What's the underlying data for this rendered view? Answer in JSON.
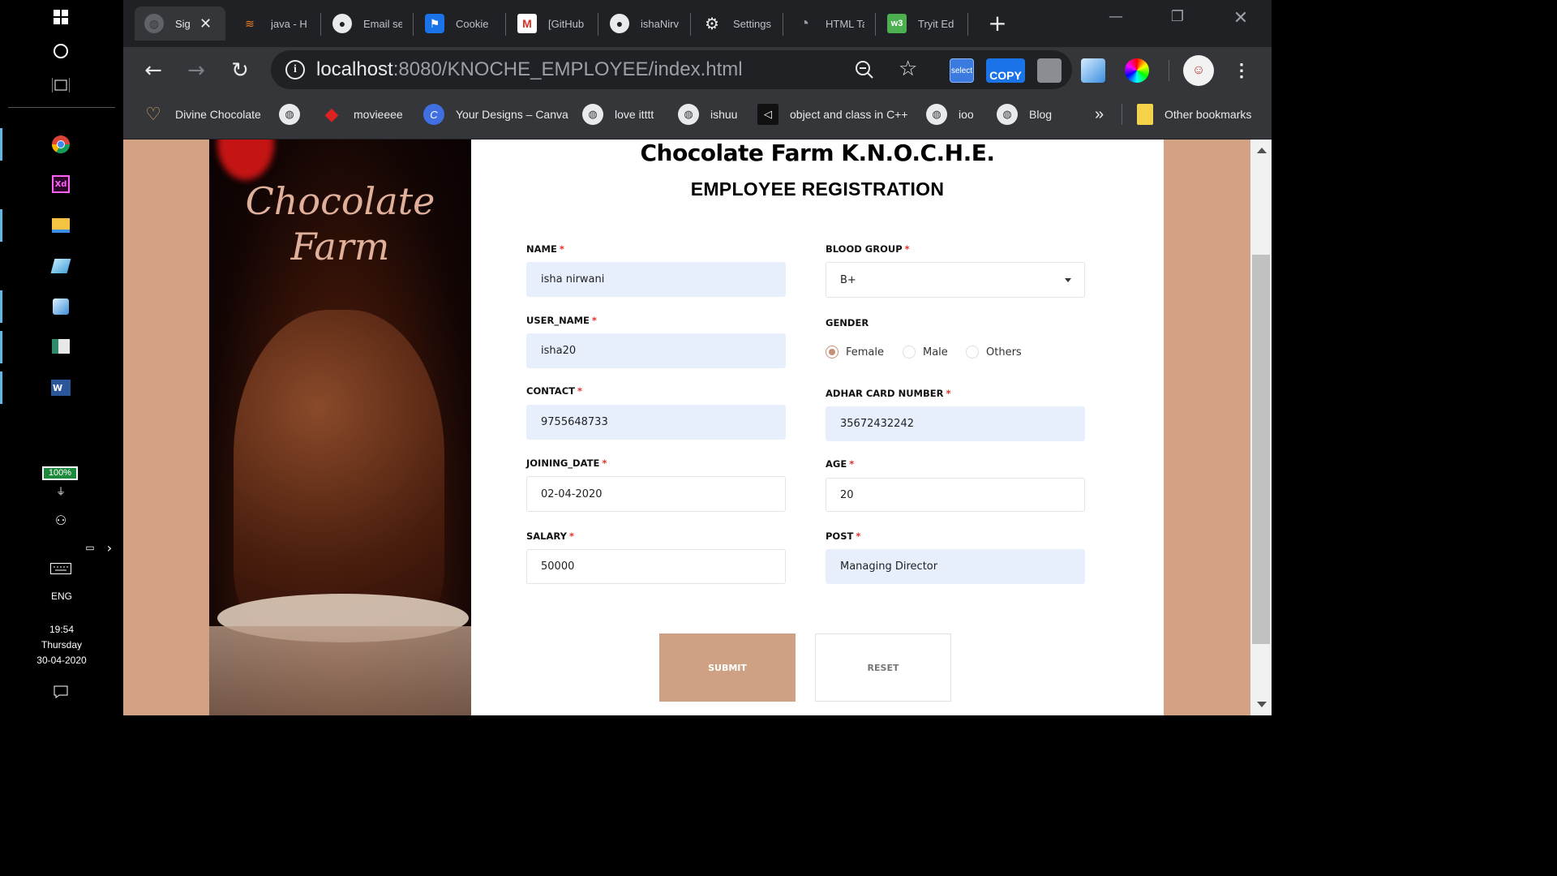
{
  "taskbar": {
    "battery": "100%",
    "language": "ENG",
    "time": "19:54",
    "day": "Thursday",
    "date": "30-04-2020",
    "icons": [
      "windows-icon",
      "cortana-icon",
      "task-view-icon",
      "chrome-icon",
      "xd-icon",
      "file-explorer-icon",
      "app-icon",
      "cube-icon",
      "window-app-icon",
      "word-icon",
      "power-plug-icon",
      "people-icon",
      "battery-icon",
      "keyboard-icon",
      "notification-icon"
    ]
  },
  "browser": {
    "tabs": [
      {
        "label": "Sig",
        "icon": "globe-icon"
      },
      {
        "label": "java - H",
        "icon": "stackoverflow-icon"
      },
      {
        "label": "Email se",
        "icon": "github-icon"
      },
      {
        "label": "Cookie",
        "icon": "flag-icon"
      },
      {
        "label": "[GitHub",
        "icon": "gmail-icon"
      },
      {
        "label": "ishaNirv",
        "icon": "github-icon"
      },
      {
        "label": "Settings",
        "icon": "gear-icon"
      },
      {
        "label": "HTML Ta",
        "icon": "loading-icon"
      },
      {
        "label": "Tryit Ed",
        "icon": "w3-icon"
      }
    ],
    "url_host": "localhost",
    "url_rest": ":8080/KNOCHE_EMPLOYEE/index.html",
    "extensions": {
      "select_label": "select",
      "copy_label": "COPY"
    },
    "bookmarks": [
      {
        "label": "Divine Chocolate"
      },
      {
        "label": ""
      },
      {
        "label": "movieeee"
      },
      {
        "label": "Your Designs – Canva"
      },
      {
        "label": "love itttt"
      },
      {
        "label": "ishuu"
      },
      {
        "label": "object and class in C++"
      },
      {
        "label": "ioo"
      },
      {
        "label": "Blog"
      }
    ],
    "other_bookmarks": "Other bookmarks",
    "more_bookmarks": "»"
  },
  "page": {
    "image_title_line1": "Chocolate",
    "image_title_line2": "Farm",
    "farm_title": "Chocolate Farm K.N.O.C.H.E.",
    "form_title": "EMPLOYEE REGISTRATION",
    "fields": {
      "name": {
        "label": "NAME",
        "value": "isha nirwani"
      },
      "user_name": {
        "label": "USER_NAME",
        "value": "isha20"
      },
      "contact": {
        "label": "CONTACT",
        "value": "9755648733"
      },
      "joining_date": {
        "label": "JOINING_DATE",
        "value": "02-04-2020"
      },
      "salary": {
        "label": "SALARY",
        "value": "50000"
      },
      "blood_group": {
        "label": "BLOOD GROUP",
        "value": "B+"
      },
      "gender": {
        "label": "GENDER",
        "options": [
          "Female",
          "Male",
          "Others"
        ],
        "selected": "Female"
      },
      "adhar": {
        "label": "ADHAR CARD NUMBER",
        "value": "35672432242"
      },
      "age": {
        "label": "AGE",
        "value": "20"
      },
      "post": {
        "label": "POST",
        "value": "Managing Director"
      }
    },
    "required_mark": "*",
    "submit_label": "SUBMIT",
    "reset_label": "RESET"
  },
  "colors": {
    "page_bg": "#d3a284",
    "accent": "#cfa184",
    "input_filled": "#e7effd",
    "required": "#e4302b"
  }
}
